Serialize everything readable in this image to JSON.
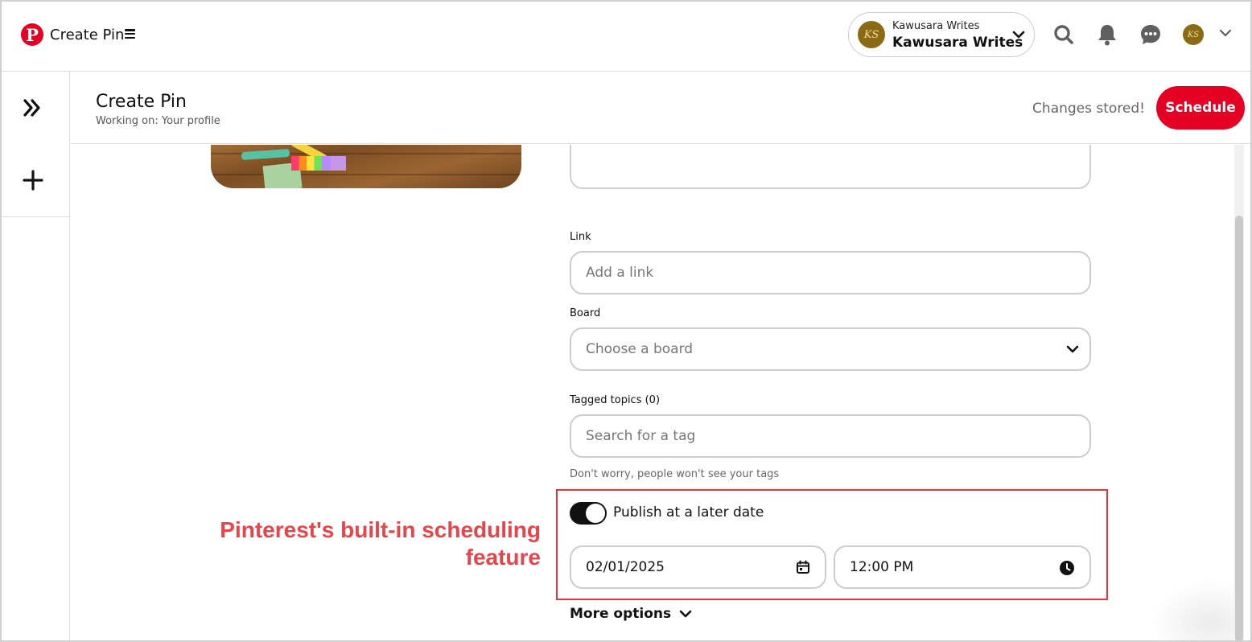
{
  "topbar": {
    "app_title": "Create Pin",
    "account_switcher": {
      "name_small": "Kawusara Writes",
      "name_large": "Kawusara Writes",
      "avatar_initials": "KS"
    },
    "user_avatar_initials": "KS",
    "icons": [
      "pinterest-logo-icon",
      "menu-icon",
      "chevron-down-icon",
      "search-icon",
      "bell-icon",
      "chat-icon",
      "chevron-down-icon"
    ]
  },
  "rail": {
    "icons": [
      "double-chevron-right-icon",
      "plus-icon"
    ]
  },
  "header": {
    "title": "Create Pin",
    "subtitle": "Working on: Your profile",
    "status": "Changes stored!",
    "schedule_label": "Schedule"
  },
  "form": {
    "link": {
      "label": "Link",
      "placeholder": "Add a link"
    },
    "board": {
      "label": "Board",
      "placeholder": "Choose a board"
    },
    "tags": {
      "label": "Tagged topics (0)",
      "placeholder": "Search for a tag",
      "help": "Don't worry, people won't see your tags"
    },
    "publish_later": {
      "label": "Publish at a later date",
      "enabled": true
    },
    "date": "02/01/2025",
    "time": "12:00 PM",
    "more_options": "More options"
  },
  "annotation": {
    "line1": "Pinterest's built-in scheduling",
    "line2": "feature",
    "color": "#e8444a"
  },
  "colors": {
    "brand": "#e60023",
    "highlight": "#e2333f"
  }
}
